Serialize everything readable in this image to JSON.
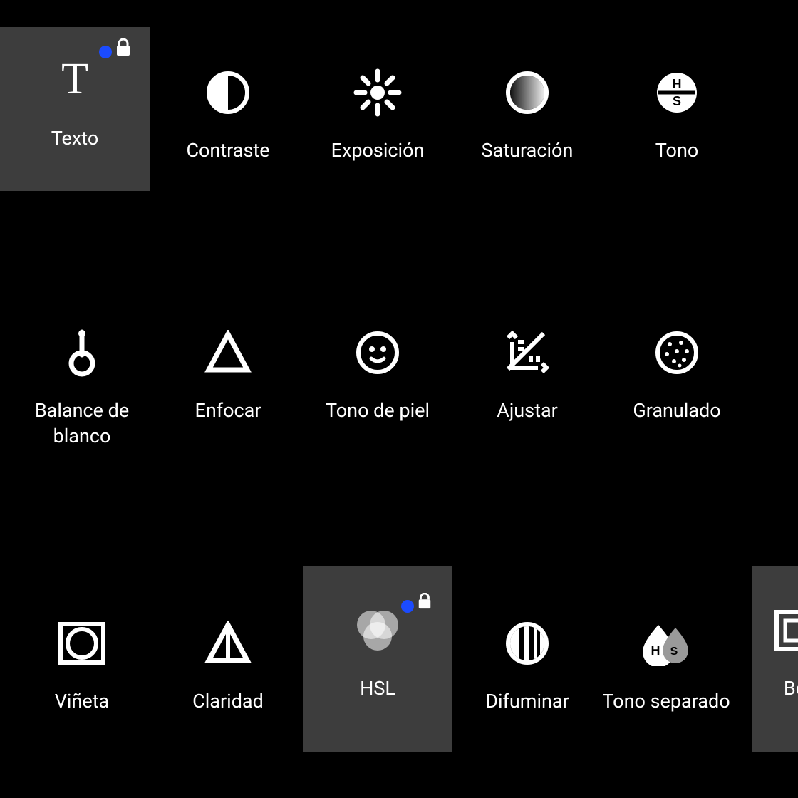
{
  "tools": [
    {
      "id": "texto",
      "label": "Texto",
      "selected": true,
      "locked": true,
      "dot": true
    },
    {
      "id": "contraste",
      "label": "Contraste",
      "selected": false,
      "locked": false,
      "dot": false
    },
    {
      "id": "exposicion",
      "label": "Exposición",
      "selected": false,
      "locked": false,
      "dot": false
    },
    {
      "id": "saturacion",
      "label": "Saturación",
      "selected": false,
      "locked": false,
      "dot": false
    },
    {
      "id": "tono",
      "label": "Tono",
      "selected": false,
      "locked": false,
      "dot": false
    },
    {
      "id": "balance",
      "label": "Balance de\nblanco",
      "selected": false,
      "locked": false,
      "dot": false
    },
    {
      "id": "enfocar",
      "label": "Enfocar",
      "selected": false,
      "locked": false,
      "dot": false
    },
    {
      "id": "skintone",
      "label": "Tono de piel",
      "selected": false,
      "locked": false,
      "dot": false
    },
    {
      "id": "ajustar",
      "label": "Ajustar",
      "selected": false,
      "locked": false,
      "dot": false
    },
    {
      "id": "granulado",
      "label": "Granulado",
      "selected": false,
      "locked": false,
      "dot": false
    },
    {
      "id": "vineta",
      "label": "Viñeta",
      "selected": false,
      "locked": false,
      "dot": false
    },
    {
      "id": "claridad",
      "label": "Claridad",
      "selected": false,
      "locked": false,
      "dot": false
    },
    {
      "id": "hsl",
      "label": "HSL",
      "selected": true,
      "locked": true,
      "dot": true
    },
    {
      "id": "difuminar",
      "label": "Difuminar",
      "selected": false,
      "locked": false,
      "dot": false
    },
    {
      "id": "splittone",
      "label": "Tono separado",
      "selected": false,
      "locked": false,
      "dot": false
    },
    {
      "id": "bo",
      "label": "Bo",
      "selected": true,
      "locked": false,
      "dot": false
    }
  ]
}
